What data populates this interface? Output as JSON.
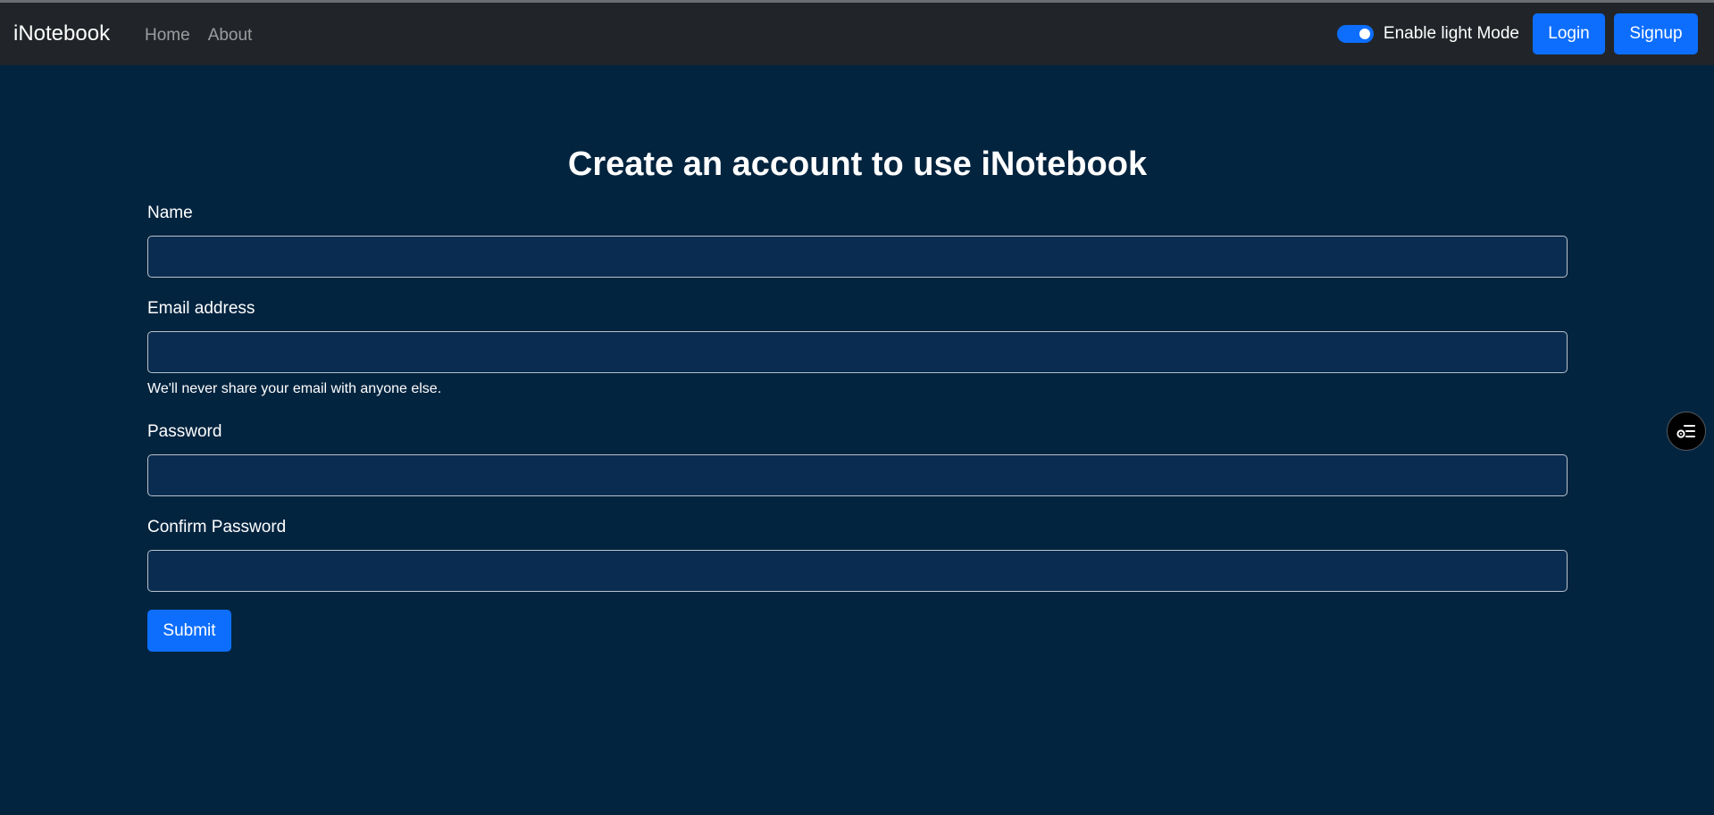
{
  "navbar": {
    "brand": "iNotebook",
    "links": [
      {
        "label": "Home"
      },
      {
        "label": "About"
      }
    ],
    "theme_toggle_label": "Enable light Mode",
    "login_label": "Login",
    "signup_label": "Signup"
  },
  "form": {
    "title": "Create an account to use iNotebook",
    "fields": [
      {
        "label": "Name",
        "value": ""
      },
      {
        "label": "Email address",
        "value": "",
        "help": "We'll never share your email with anyone else."
      },
      {
        "label": "Password",
        "value": ""
      },
      {
        "label": "Confirm Password",
        "value": ""
      }
    ],
    "submit_label": "Submit"
  },
  "floating_button": {
    "icon": "settings-list-icon"
  },
  "colors": {
    "navbar_bg": "#212529",
    "page_bg": "#03243f",
    "input_bg": "#0a2c50",
    "primary": "#0d6efd"
  }
}
